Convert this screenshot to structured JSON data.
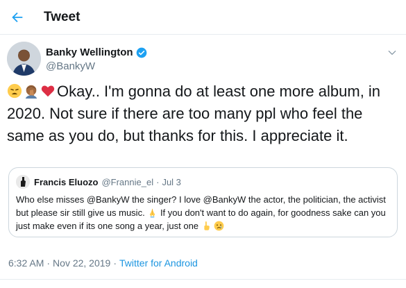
{
  "header": {
    "title": "Tweet",
    "back_icon": "back-arrow-icon",
    "accent": "#1da1f2"
  },
  "author": {
    "display_name": "Banky Wellington",
    "handle": "@BankyW",
    "verified_icon": "verified-badge-icon",
    "menu_icon": "chevron-down-icon"
  },
  "tweet": {
    "emojis": [
      "weary-face-emoji",
      "man-facepalming-emoji",
      "red-heart-emoji"
    ],
    "text": "Okay.. I'm gonna do at least one more album, in 2020. Not sure if there are too many ppl who feel the same as you do, but thanks for this. I appreciate it."
  },
  "quote": {
    "name": "Francis Eluozo",
    "handle": "@Frannie_el",
    "separator": "·",
    "date": "Jul 3",
    "text_1": "Who else misses @BankyW the singer? I love @BankyW the actor, the politician, the activist but please sir still give us music.",
    "text_2": "If you don't want to do again, for goodness sake can you just make even if its one song a year, just one",
    "emojis": [
      "folded-hands-emoji",
      "index-pointing-up-emoji",
      "crying-face-emoji"
    ]
  },
  "meta": {
    "time": "6:32 AM",
    "separator": "·",
    "date": "Nov 22, 2019",
    "source": "Twitter for Android"
  }
}
